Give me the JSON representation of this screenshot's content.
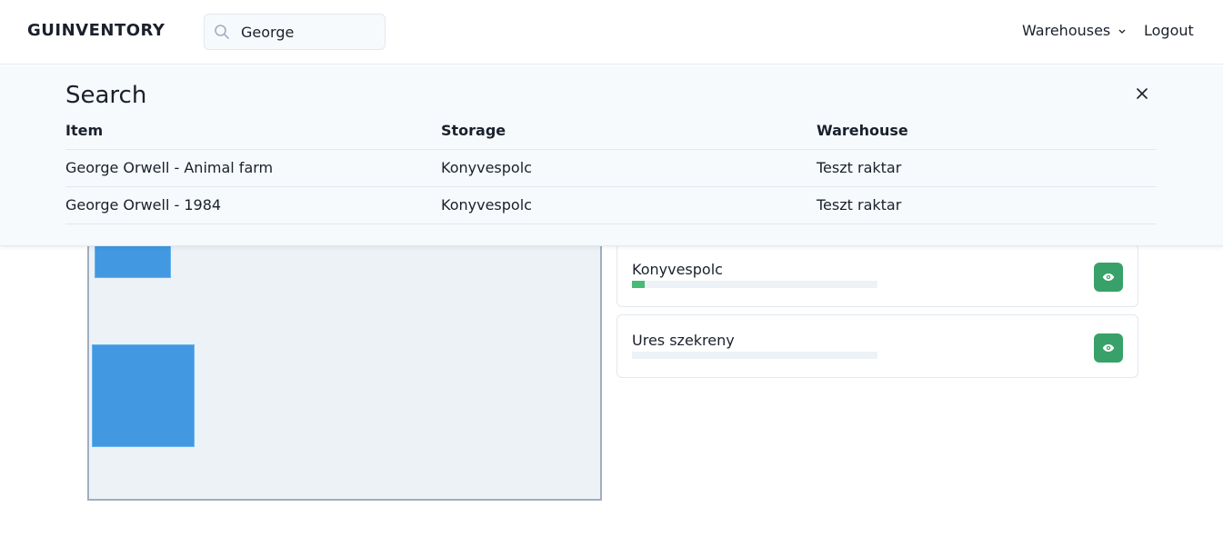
{
  "app": {
    "brand": "GUINVENTORY"
  },
  "nav": {
    "search_value": "George",
    "warehouses_label": "Warehouses",
    "logout_label": "Logout"
  },
  "search": {
    "title": "Search",
    "columns": [
      "Item",
      "Storage",
      "Warehouse"
    ],
    "rows": [
      {
        "item": "George Orwell - Animal farm",
        "storage": "Konyvespolc",
        "warehouse": "Teszt raktar"
      },
      {
        "item": "George Orwell - 1984",
        "storage": "Konyvespolc",
        "warehouse": "Teszt raktar"
      }
    ]
  },
  "storages": [
    {
      "name": "Konyvespolc",
      "fill_fraction": 0.05
    },
    {
      "name": "Ures szekreny",
      "fill_fraction": 0.0
    }
  ],
  "colors": {
    "accent_green": "#38a169",
    "progress_green": "#48bb78",
    "shape_blue": "#4299e1"
  },
  "icons": {
    "search": "search-icon",
    "chevron": "chevron-down-icon",
    "close": "close-icon",
    "view": "eye-icon"
  }
}
